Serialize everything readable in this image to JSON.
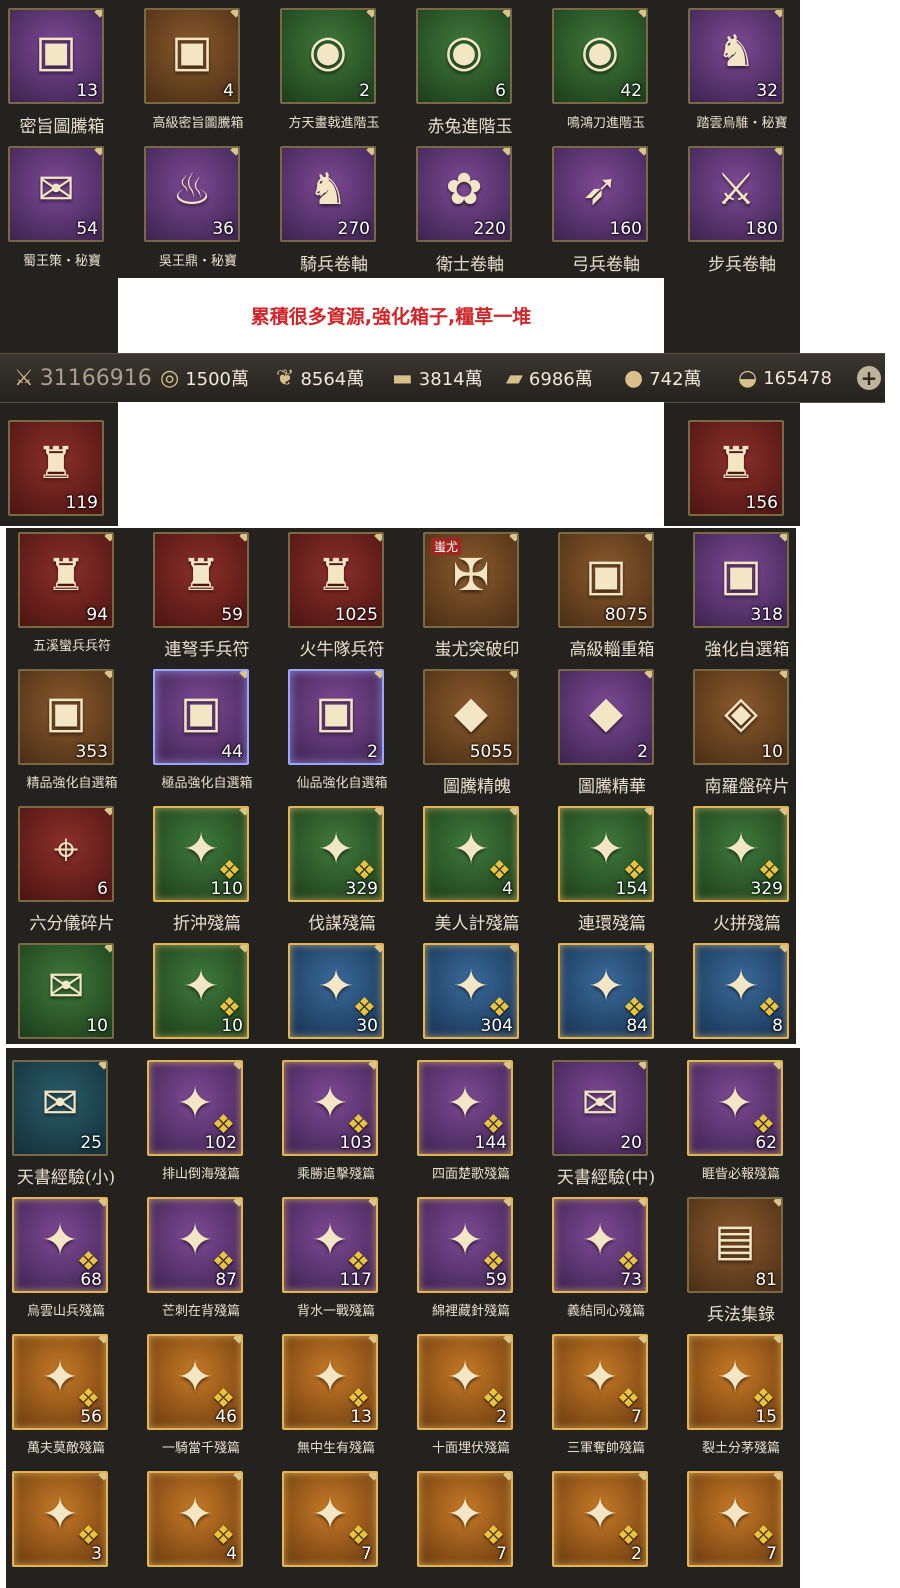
{
  "section1": {
    "rows": [
      [
        {
          "label": "密旨圖騰箱",
          "qty": "13",
          "icon": "totem-chest-icon",
          "bg": "purple",
          "size": "normal"
        },
        {
          "label": "高級密旨圖騰箱",
          "qty": "4",
          "icon": "advanced-totem-chest-icon",
          "bg": "brown",
          "size": "small"
        },
        {
          "label": "方天畫戟進階玉",
          "qty": "2",
          "icon": "halberd-jade-icon",
          "bg": "green",
          "size": "small"
        },
        {
          "label": "赤兔進階玉",
          "qty": "6",
          "icon": "red-hare-jade-icon",
          "bg": "green",
          "size": "normal"
        },
        {
          "label": "鳴鴻刀進階玉",
          "qty": "42",
          "icon": "blade-jade-icon",
          "bg": "green",
          "size": "small"
        },
        {
          "label": "踏雲烏騅・秘寶",
          "qty": "32",
          "icon": "black-horse-treasure-icon",
          "bg": "purple",
          "size": "small"
        }
      ],
      [
        {
          "label": "蜀王策・秘寶",
          "qty": "54",
          "icon": "shu-scroll-treasure-icon",
          "bg": "purple",
          "size": "small"
        },
        {
          "label": "吳王鼎・秘寶",
          "qty": "36",
          "icon": "wu-cauldron-treasure-icon",
          "bg": "purple",
          "size": "small"
        },
        {
          "label": "騎兵卷軸",
          "qty": "270",
          "icon": "cavalry-scroll-icon",
          "bg": "purple",
          "size": "normal"
        },
        {
          "label": "衛士卷軸",
          "qty": "220",
          "icon": "guard-scroll-icon",
          "bg": "purple",
          "size": "normal"
        },
        {
          "label": "弓兵卷軸",
          "qty": "160",
          "icon": "archer-scroll-icon",
          "bg": "purple",
          "size": "normal"
        },
        {
          "label": "步兵卷軸",
          "qty": "180",
          "icon": "infantry-scroll-icon",
          "bg": "purple",
          "size": "normal"
        }
      ]
    ],
    "banner": "累積很多資源,強化箱子,糧草一堆"
  },
  "resources": {
    "power": "31166916",
    "items": [
      {
        "icon": "coin-icon",
        "value": "1500萬"
      },
      {
        "icon": "grain-icon",
        "value": "8564萬"
      },
      {
        "icon": "wood-icon",
        "value": "3814萬"
      },
      {
        "icon": "iron-icon",
        "value": "6986萬"
      },
      {
        "icon": "money-bag-icon",
        "value": "742萬"
      },
      {
        "icon": "gold-ingot-icon",
        "value": "165478"
      }
    ]
  },
  "side_cards": [
    {
      "qty": "119",
      "icon": "soldier-token-icon"
    },
    {
      "qty": "156",
      "icon": "soldier-token-icon"
    }
  ],
  "section2": {
    "rows": [
      [
        {
          "label": "五溪蠻兵兵符",
          "qty": "94",
          "icon": "wuxi-soldier-token-icon",
          "bg": "red",
          "size": "small"
        },
        {
          "label": "連弩手兵符",
          "qty": "59",
          "icon": "crossbow-soldier-token-icon",
          "bg": "red",
          "size": "normal"
        },
        {
          "label": "火牛隊兵符",
          "qty": "1025",
          "icon": "fire-ox-token-icon",
          "bg": "red",
          "size": "normal"
        },
        {
          "label": "蚩尤突破印",
          "qty": "",
          "icon": "chiyou-seal-icon",
          "bg": "brown",
          "size": "normal",
          "badge": "蚩尤"
        },
        {
          "label": "高級輜重箱",
          "qty": "8075",
          "icon": "treasure-chest-icon",
          "bg": "brown",
          "size": "normal"
        },
        {
          "label": "強化自選箱",
          "qty": "318",
          "icon": "enhance-chest-icon",
          "bg": "purple",
          "size": "normal"
        }
      ],
      [
        {
          "label": "精品強化自選箱",
          "qty": "353",
          "icon": "fine-enhance-chest-icon",
          "bg": "brown",
          "size": "small"
        },
        {
          "label": "極品強化自選箱",
          "qty": "44",
          "icon": "superb-enhance-chest-icon",
          "bg": "purple",
          "size": "small",
          "glow": "blue"
        },
        {
          "label": "仙品強化自選箱",
          "qty": "2",
          "icon": "immortal-enhance-chest-icon",
          "bg": "purple",
          "size": "small",
          "glow": "blue"
        },
        {
          "label": "圖騰精魄",
          "qty": "5055",
          "icon": "red-crystal-icon",
          "bg": "brown",
          "size": "normal"
        },
        {
          "label": "圖騰精華",
          "qty": "2",
          "icon": "blue-crystal-icon",
          "bg": "purple",
          "size": "normal"
        },
        {
          "label": "南羅盤碎片",
          "qty": "10",
          "icon": "compass-shard-icon",
          "bg": "brown",
          "size": "normal"
        }
      ],
      [
        {
          "label": "六分儀碎片",
          "qty": "6",
          "icon": "sextant-shard-icon",
          "bg": "red",
          "size": "normal"
        },
        {
          "label": "折沖殘篇",
          "qty": "110",
          "icon": "tactic-fragment-icon",
          "bg": "green",
          "size": "normal",
          "piece": true
        },
        {
          "label": "伐謀殘篇",
          "qty": "329",
          "icon": "tactic-fragment-icon",
          "bg": "green",
          "size": "normal",
          "piece": true
        },
        {
          "label": "美人計殘篇",
          "qty": "4",
          "icon": "tactic-fragment-icon",
          "bg": "green",
          "size": "normal",
          "piece": true
        },
        {
          "label": "連環殘篇",
          "qty": "154",
          "icon": "tactic-fragment-icon",
          "bg": "green",
          "size": "normal",
          "piece": true
        },
        {
          "label": "火拼殘篇",
          "qty": "329",
          "icon": "tactic-fragment-icon",
          "bg": "green",
          "size": "normal",
          "piece": true
        }
      ],
      [
        {
          "label": "",
          "qty": "10",
          "icon": "scroll-icon",
          "bg": "green",
          "size": "normal"
        },
        {
          "label": "",
          "qty": "10",
          "icon": "tactic-fragment-icon",
          "bg": "green",
          "size": "normal",
          "piece": true
        },
        {
          "label": "",
          "qty": "30",
          "icon": "tactic-fragment-icon",
          "bg": "blue",
          "size": "normal",
          "piece": true
        },
        {
          "label": "",
          "qty": "304",
          "icon": "tactic-fragment-icon",
          "bg": "blue",
          "size": "normal",
          "piece": true
        },
        {
          "label": "",
          "qty": "84",
          "icon": "tactic-fragment-icon",
          "bg": "blue",
          "size": "normal",
          "piece": true
        },
        {
          "label": "",
          "qty": "8",
          "icon": "tactic-fragment-icon",
          "bg": "blue",
          "size": "normal",
          "piece": true
        }
      ]
    ]
  },
  "section3": {
    "rows": [
      [
        {
          "label": "天書經驗(小)",
          "qty": "25",
          "icon": "scroll-icon",
          "bg": "teal",
          "size": "normal"
        },
        {
          "label": "排山倒海殘篇",
          "qty": "102",
          "icon": "tactic-fragment-icon",
          "bg": "purple",
          "size": "small",
          "piece": true
        },
        {
          "label": "乘勝追擊殘篇",
          "qty": "103",
          "icon": "tactic-fragment-icon",
          "bg": "purple",
          "size": "small",
          "piece": true
        },
        {
          "label": "四面楚歌殘篇",
          "qty": "144",
          "icon": "tactic-fragment-icon",
          "bg": "purple",
          "size": "small",
          "piece": true
        },
        {
          "label": "天書經驗(中)",
          "qty": "20",
          "icon": "scroll-icon",
          "bg": "purple",
          "size": "normal"
        },
        {
          "label": "睚眥必報殘篇",
          "qty": "62",
          "icon": "tactic-fragment-icon",
          "bg": "purple",
          "size": "small",
          "piece": true
        }
      ],
      [
        {
          "label": "烏雲山兵殘篇",
          "qty": "68",
          "icon": "tactic-fragment-icon",
          "bg": "purple",
          "size": "small",
          "piece": true
        },
        {
          "label": "芒刺在背殘篇",
          "qty": "87",
          "icon": "tactic-fragment-icon",
          "bg": "purple",
          "size": "small",
          "piece": true
        },
        {
          "label": "背水一戰殘篇",
          "qty": "117",
          "icon": "tactic-fragment-icon",
          "bg": "purple",
          "size": "small",
          "piece": true
        },
        {
          "label": "綿裡藏針殘篇",
          "qty": "59",
          "icon": "tactic-fragment-icon",
          "bg": "purple",
          "size": "small",
          "piece": true
        },
        {
          "label": "義結同心殘篇",
          "qty": "73",
          "icon": "tactic-fragment-icon",
          "bg": "purple",
          "size": "small",
          "piece": true
        },
        {
          "label": "兵法集錄",
          "qty": "81",
          "icon": "book-icon",
          "bg": "brown",
          "size": "normal"
        }
      ],
      [
        {
          "label": "萬夫莫敵殘篇",
          "qty": "56",
          "icon": "tactic-fragment-icon",
          "bg": "gold",
          "size": "small",
          "piece": true
        },
        {
          "label": "一騎當千殘篇",
          "qty": "46",
          "icon": "tactic-fragment-icon",
          "bg": "gold",
          "size": "small",
          "piece": true
        },
        {
          "label": "無中生有殘篇",
          "qty": "13",
          "icon": "tactic-fragment-icon",
          "bg": "gold",
          "size": "small",
          "piece": true
        },
        {
          "label": "十面埋伏殘篇",
          "qty": "2",
          "icon": "tactic-fragment-icon",
          "bg": "gold",
          "size": "small",
          "piece": true
        },
        {
          "label": "三軍奪帥殘篇",
          "qty": "7",
          "icon": "tactic-fragment-icon",
          "bg": "gold",
          "size": "small",
          "piece": true
        },
        {
          "label": "裂土分茅殘篇",
          "qty": "15",
          "icon": "tactic-fragment-icon",
          "bg": "gold",
          "size": "small",
          "piece": true
        }
      ],
      [
        {
          "label": "",
          "qty": "3",
          "icon": "tactic-fragment-icon",
          "bg": "gold",
          "size": "small",
          "piece": true
        },
        {
          "label": "",
          "qty": "4",
          "icon": "tactic-fragment-icon",
          "bg": "gold",
          "size": "small",
          "piece": true
        },
        {
          "label": "",
          "qty": "7",
          "icon": "tactic-fragment-icon",
          "bg": "gold",
          "size": "small",
          "piece": true
        },
        {
          "label": "",
          "qty": "7",
          "icon": "tactic-fragment-icon",
          "bg": "gold",
          "size": "small",
          "piece": true
        },
        {
          "label": "",
          "qty": "2",
          "icon": "tactic-fragment-icon",
          "bg": "gold",
          "size": "small",
          "piece": true
        },
        {
          "label": "",
          "qty": "7",
          "icon": "tactic-fragment-icon",
          "bg": "gold",
          "size": "small",
          "piece": true
        }
      ]
    ]
  }
}
